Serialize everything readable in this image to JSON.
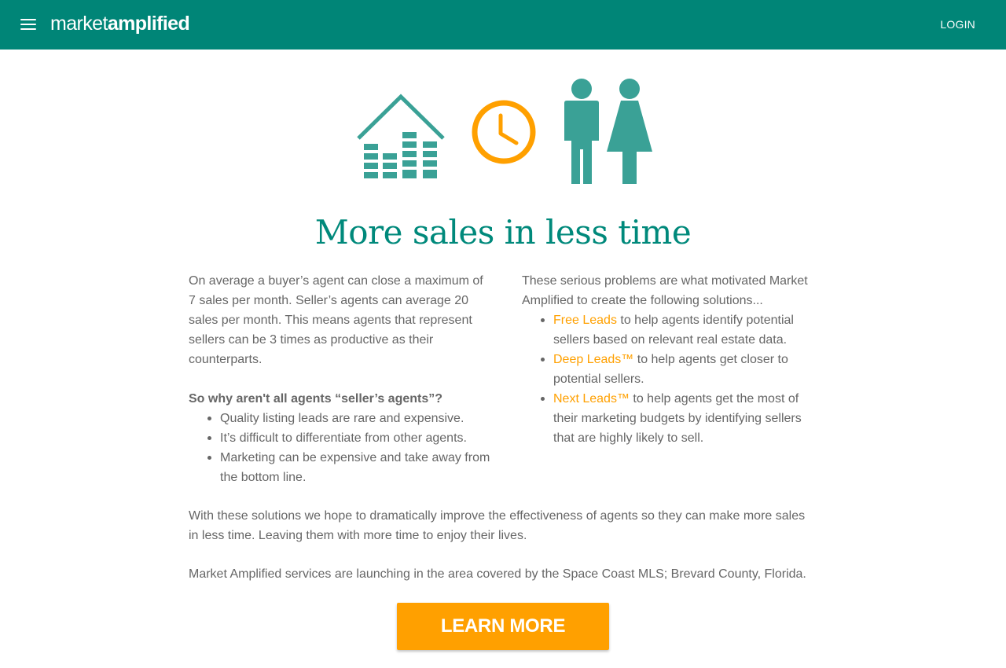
{
  "brand": {
    "light": "market",
    "bold": "amplified"
  },
  "nav": {
    "login": "LOGIN"
  },
  "colors": {
    "primary": "#008577",
    "accent": "#ffa000",
    "icon": "#3aa196"
  },
  "icons": [
    "menu-icon",
    "house-bars-icon",
    "clock-icon",
    "people-icon"
  ],
  "headline": "More sales in less time",
  "left": {
    "intro": "On average a buyer’s agent can close a maximum of 7 sales per month. Seller’s agents can average 20 sales per month. This means agents that represent sellers can be 3 times as productive as their counterparts.",
    "question": "So why aren't all agents “seller’s agents”?",
    "problems": [
      "Quality listing leads are rare and expensive.",
      "It’s difficult to differentiate from other agents.",
      "Marketing can be expensive and take away from the bottom line."
    ]
  },
  "right": {
    "intro": "These serious problems are what motivated Market Amplified to create the following solutions...",
    "solutions": [
      {
        "link": "Free Leads",
        "text": " to help agents identify potential sellers based on relevant real estate data."
      },
      {
        "link": "Deep Leads™",
        "text": " to help agents get closer to potential sellers."
      },
      {
        "link": "Next Leads™",
        "text": " to help agents get the most of their marketing budgets by identifying sellers that are highly likely to sell."
      }
    ]
  },
  "closing": "With these solutions we hope to dramatically improve the effectiveness of agents so they can make more sales in less time. Leaving them with more time to enjoy their lives.",
  "launch": "Market Amplified services are launching in the area covered by the Space Coast MLS; Brevard County, Florida.",
  "cta": "LEARN MORE"
}
